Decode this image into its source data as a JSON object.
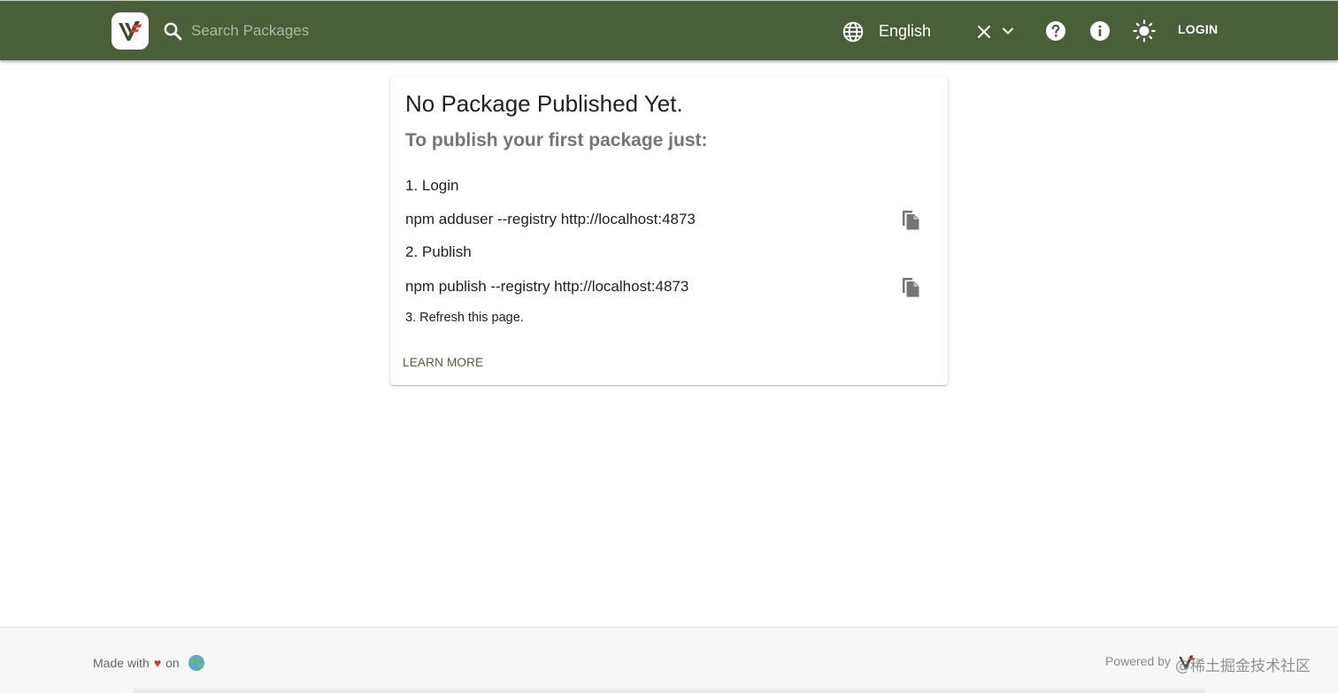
{
  "header": {
    "search": {
      "placeholder": "Search Packages",
      "value": ""
    },
    "language": {
      "value": "English"
    },
    "login_label": "LOGIN"
  },
  "card": {
    "title": "No Package Published Yet.",
    "subtitle": "To publish your first package just:",
    "steps": [
      {
        "label": "1. Login",
        "command": "npm adduser --registry http://localhost:4873"
      },
      {
        "label": "2. Publish",
        "command": "npm publish --registry http://localhost:4873"
      },
      {
        "label": "3. Refresh this page."
      }
    ],
    "learn_more_label": "LEARN MORE"
  },
  "footer": {
    "made_with": "Made with",
    "heart": "♥",
    "on": "on",
    "powered_by": "Powered by",
    "watermark": "@稀土掘金技术社区"
  },
  "icons": {
    "logo": "verdaccio-logo-icon",
    "search": "search-icon",
    "language": "globe-icon",
    "clear": "close-icon",
    "dropdown": "chevron-down-icon",
    "help": "help-circle-icon",
    "info": "info-circle-icon",
    "theme": "sun-icon",
    "copy": "copy-icon",
    "earth": "earth-globe-icon"
  },
  "colors": {
    "header_bg": "#4a5e38",
    "accent": "#4a5e38",
    "heart": "#d32f2f",
    "logo_red": "#e53935",
    "logo_dark": "#3b4a2c"
  }
}
